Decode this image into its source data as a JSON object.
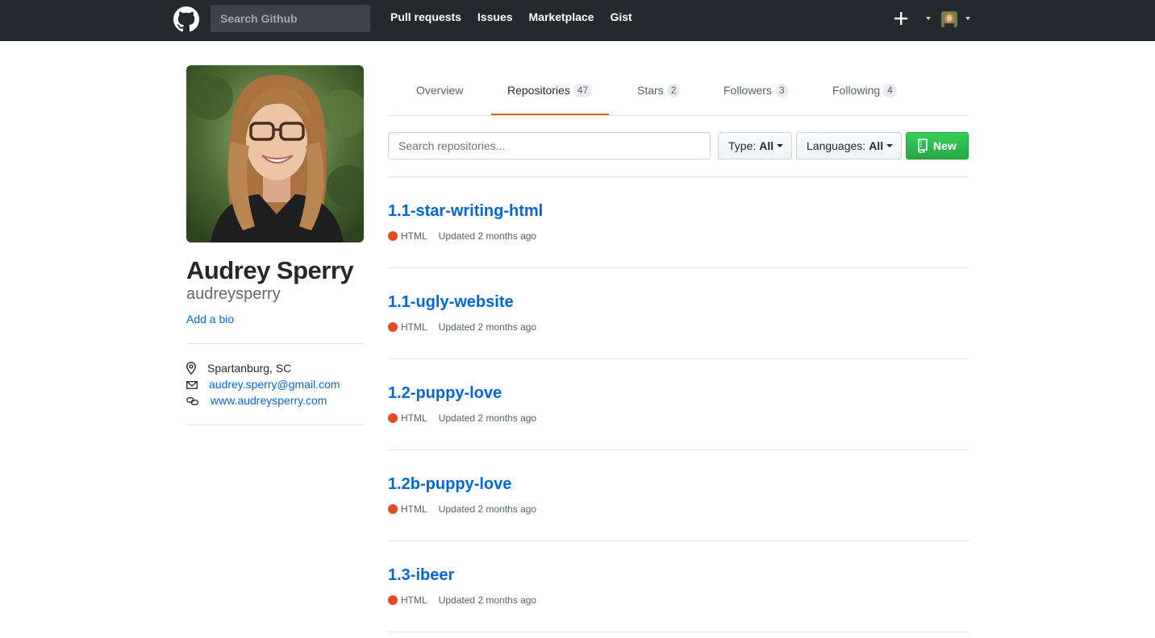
{
  "header": {
    "search_placeholder": "Search Github",
    "nav": [
      "Pull requests",
      "Issues",
      "Marketplace",
      "Gist"
    ]
  },
  "profile": {
    "full_name": "Audrey Sperry",
    "username": "audreysperry",
    "add_bio": "Add a bio",
    "location": "Spartanburg, SC",
    "email": "audrey.sperry@gmail.com",
    "website": "www.audreysperry.com"
  },
  "tabs": [
    {
      "label": "Overview",
      "count": ""
    },
    {
      "label": "Repositories",
      "count": "47"
    },
    {
      "label": "Stars",
      "count": "2"
    },
    {
      "label": "Followers",
      "count": "3"
    },
    {
      "label": "Following",
      "count": "4"
    }
  ],
  "filters": {
    "search_placeholder": "Search repositories...",
    "type_label": "Type:",
    "type_value": "All",
    "languages_label": "Languages:",
    "languages_value": "All",
    "new_label": "New"
  },
  "colors": {
    "accent_tab": "#e36209",
    "link": "#0366d6",
    "new_button": "#28a745",
    "html_lang": "#e34c26"
  },
  "repos": [
    {
      "name": "1.1-star-writing-html",
      "language": "HTML",
      "updated": "Updated 2 months ago"
    },
    {
      "name": "1.1-ugly-website",
      "language": "HTML",
      "updated": "Updated 2 months ago"
    },
    {
      "name": "1.2-puppy-love",
      "language": "HTML",
      "updated": "Updated 2 months ago"
    },
    {
      "name": "1.2b-puppy-love",
      "language": "HTML",
      "updated": "Updated 2 months ago"
    },
    {
      "name": "1.3-ibeer",
      "language": "HTML",
      "updated": "Updated 2 months ago"
    }
  ]
}
